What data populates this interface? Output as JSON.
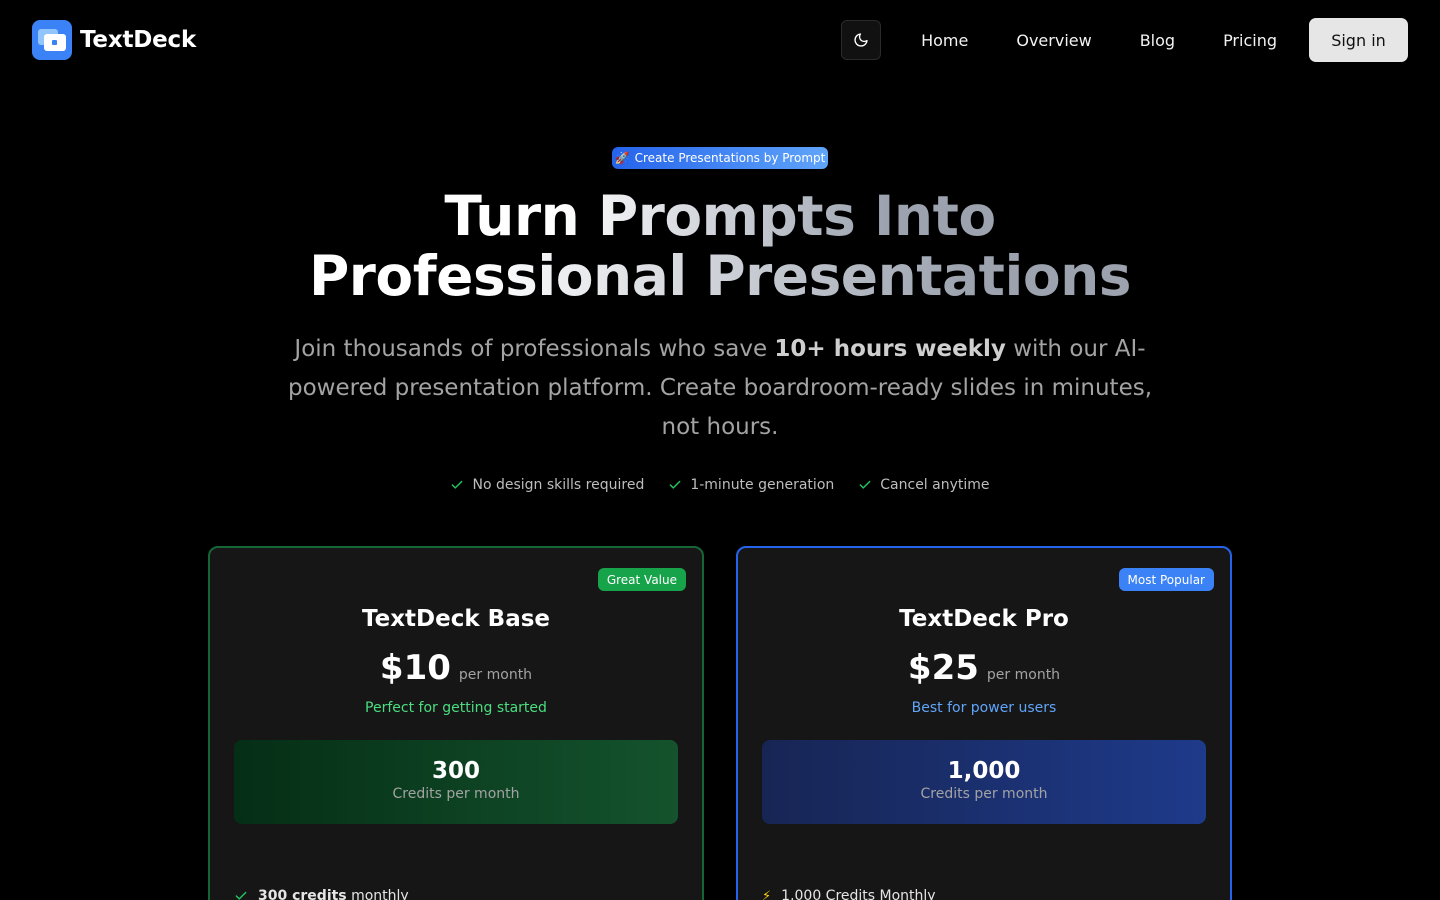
{
  "nav": {
    "brand": "TextDeck",
    "links": [
      "Home",
      "Overview",
      "Blog",
      "Pricing"
    ],
    "signin": "Sign in"
  },
  "hero": {
    "pill_emoji": "🚀",
    "pill": "Create Presentations by Prompt",
    "title_line1": "Turn Prompts Into",
    "title_line2": "Professional Presentations",
    "sub_pre": "Join thousands of professionals who save ",
    "sub_bold": "10+ hours weekly",
    "sub_post": " with our AI-powered presentation platform. Create boardroom-ready slides in minutes, not hours.",
    "checks": [
      "No design skills required",
      "1-minute generation",
      "Cancel anytime"
    ]
  },
  "plans": [
    {
      "badge": "Great Value",
      "name": "TextDeck Base",
      "price": "$10",
      "per": "per month",
      "tagline": "Perfect for getting started",
      "credits": "300",
      "credits_label": "Credits per month",
      "feature_bold": "300 credits",
      "feature_rest": " monthly"
    },
    {
      "badge": "Most Popular",
      "name": "TextDeck Pro",
      "price": "$25",
      "per": "per month",
      "tagline": "Best for power users",
      "credits": "1,000",
      "credits_label": "Credits per month",
      "feature_text": "1,000 Credits Monthly"
    }
  ],
  "colors": {
    "accent_blue": "#3b82f6",
    "accent_green": "#16a34a"
  }
}
